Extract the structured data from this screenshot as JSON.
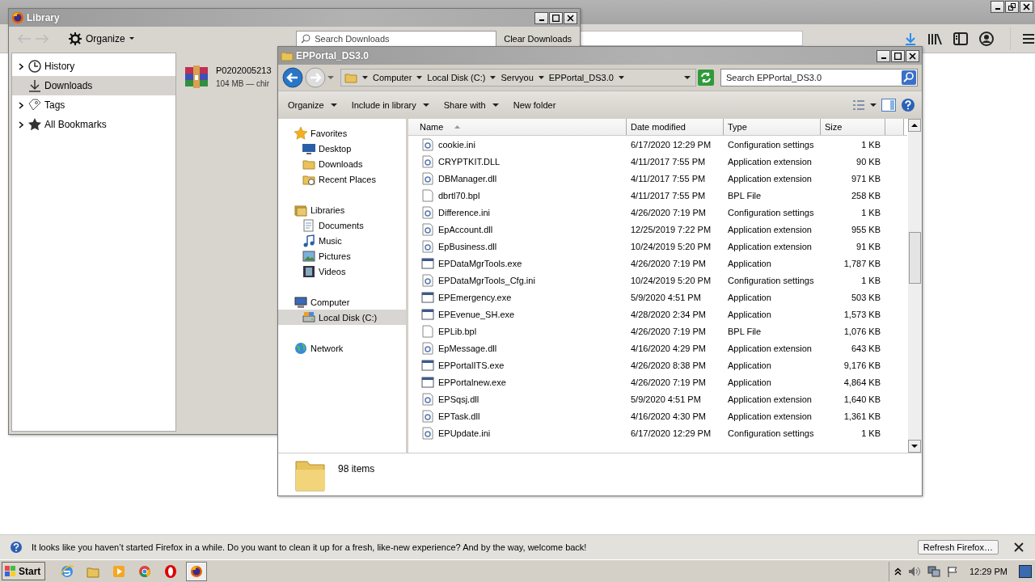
{
  "firefox": {
    "notification": {
      "message": "It looks like you haven’t started Firefox in a while. Do you want to clean it up for a fresh, like-new experience? And by the way, welcome back!",
      "button": "Refresh Firefox…"
    }
  },
  "library": {
    "title": "Library",
    "organize": "Organize",
    "search_placeholder": "Search Downloads",
    "clear_button": "Clear Downloads",
    "sidebar": [
      {
        "kind": "history",
        "label": "History",
        "expandable": true,
        "selected": false
      },
      {
        "kind": "downloads",
        "label": "Downloads",
        "expandable": false,
        "selected": true
      },
      {
        "kind": "tags",
        "label": "Tags",
        "expandable": true,
        "selected": false
      },
      {
        "kind": "bookmarks",
        "label": "All Bookmarks",
        "expandable": true,
        "selected": false
      }
    ],
    "downloads": [
      {
        "name": "P0202005213",
        "details": "104 MB — chir"
      }
    ]
  },
  "explorer": {
    "title": "EPPortal_DS3.0",
    "breadcrumbs": [
      "Computer",
      "Local Disk (C:)",
      "Servyou",
      "EPPortal_DS3.0"
    ],
    "search_placeholder": "Search EPPortal_DS3.0",
    "commands": [
      {
        "label": "Organize",
        "dropdown": true
      },
      {
        "label": "Include in library",
        "dropdown": true
      },
      {
        "label": "Share with",
        "dropdown": true
      },
      {
        "label": "New folder",
        "dropdown": false
      }
    ],
    "nav": [
      {
        "kind": "favorites",
        "label": "Favorites",
        "selected": false,
        "children": [
          {
            "kind": "desktop",
            "label": "Desktop",
            "selected": false
          },
          {
            "kind": "folder",
            "label": "Downloads",
            "selected": false
          },
          {
            "kind": "recent",
            "label": "Recent Places",
            "selected": false
          }
        ]
      },
      {
        "kind": "libraries",
        "label": "Libraries",
        "selected": false,
        "children": [
          {
            "kind": "documents",
            "label": "Documents",
            "selected": false
          },
          {
            "kind": "music",
            "label": "Music",
            "selected": false
          },
          {
            "kind": "pictures",
            "label": "Pictures",
            "selected": false
          },
          {
            "kind": "videos",
            "label": "Videos",
            "selected": false
          }
        ]
      },
      {
        "kind": "computer",
        "label": "Computer",
        "selected": false,
        "children": [
          {
            "kind": "disk",
            "label": "Local Disk (C:)",
            "selected": true
          }
        ]
      },
      {
        "kind": "network",
        "label": "Network",
        "selected": false
      }
    ],
    "columns": [
      {
        "label": "Name",
        "sorted": true
      },
      {
        "label": "Date modified",
        "sorted": false
      },
      {
        "label": "Type",
        "sorted": false
      },
      {
        "label": "Size",
        "sorted": false
      }
    ],
    "rows": [
      {
        "kind": "ini",
        "name": "cookie.ini",
        "date": "6/17/2020 12:29 PM",
        "type": "Configuration settings",
        "size": "1 KB"
      },
      {
        "kind": "dll",
        "name": "CRYPTKIT.DLL",
        "date": "4/11/2017 7:55 PM",
        "type": "Application extension",
        "size": "90 KB"
      },
      {
        "kind": "dll",
        "name": "DBManager.dll",
        "date": "4/11/2017 7:55 PM",
        "type": "Application extension",
        "size": "971 KB"
      },
      {
        "kind": "bpl",
        "name": "dbrtl70.bpl",
        "date": "4/11/2017 7:55 PM",
        "type": "BPL File",
        "size": "258 KB"
      },
      {
        "kind": "ini",
        "name": "Difference.ini",
        "date": "4/26/2020 7:19 PM",
        "type": "Configuration settings",
        "size": "1 KB"
      },
      {
        "kind": "dll",
        "name": "EpAccount.dll",
        "date": "12/25/2019 7:22 PM",
        "type": "Application extension",
        "size": "955 KB"
      },
      {
        "kind": "dll",
        "name": "EpBusiness.dll",
        "date": "10/24/2019 5:20 PM",
        "type": "Application extension",
        "size": "91 KB"
      },
      {
        "kind": "exe",
        "name": "EPDataMgrTools.exe",
        "date": "4/26/2020 7:19 PM",
        "type": "Application",
        "size": "1,787 KB"
      },
      {
        "kind": "ini",
        "name": "EPDataMgrTools_Cfg.ini",
        "date": "10/24/2019 5:20 PM",
        "type": "Configuration settings",
        "size": "1 KB"
      },
      {
        "kind": "exe",
        "name": "EPEmergency.exe",
        "date": "5/9/2020 4:51 PM",
        "type": "Application",
        "size": "503 KB"
      },
      {
        "kind": "exe",
        "name": "EPEvenue_SH.exe",
        "date": "4/28/2020 2:34 PM",
        "type": "Application",
        "size": "1,573 KB"
      },
      {
        "kind": "bpl",
        "name": "EPLib.bpl",
        "date": "4/26/2020 7:19 PM",
        "type": "BPL File",
        "size": "1,076 KB"
      },
      {
        "kind": "dll",
        "name": "EpMessage.dll",
        "date": "4/16/2020 4:29 PM",
        "type": "Application extension",
        "size": "643 KB"
      },
      {
        "kind": "exe",
        "name": "EPPortalITS.exe",
        "date": "4/26/2020 8:38 PM",
        "type": "Application",
        "size": "9,176 KB"
      },
      {
        "kind": "exe",
        "name": "EPPortalnew.exe",
        "date": "4/26/2020 7:19 PM",
        "type": "Application",
        "size": "4,864 KB"
      },
      {
        "kind": "dll",
        "name": "EPSqsj.dll",
        "date": "5/9/2020 4:51 PM",
        "type": "Application extension",
        "size": "1,640 KB"
      },
      {
        "kind": "dll",
        "name": "EPTask.dll",
        "date": "4/16/2020 4:30 PM",
        "type": "Application extension",
        "size": "1,361 KB"
      },
      {
        "kind": "ini",
        "name": "EPUpdate.ini",
        "date": "6/17/2020 12:29 PM",
        "type": "Configuration settings",
        "size": "1 KB"
      }
    ],
    "status": "98 items"
  },
  "taskbar": {
    "start": "Start",
    "apps": [
      {
        "kind": "ie",
        "selected": false
      },
      {
        "kind": "explorer",
        "selected": false
      },
      {
        "kind": "media",
        "selected": false
      },
      {
        "kind": "chrome",
        "selected": false
      },
      {
        "kind": "opera",
        "selected": false
      },
      {
        "kind": "firefox",
        "selected": true
      }
    ],
    "clock": "12:29 PM"
  }
}
